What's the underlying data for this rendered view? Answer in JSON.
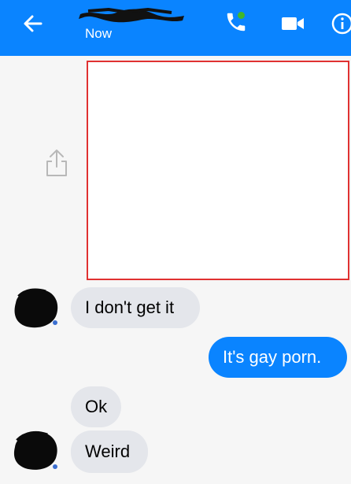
{
  "header": {
    "status": "Now",
    "colors": {
      "bar": "#0a84ff",
      "online_dot": "#42b72a"
    },
    "icons": [
      "back-arrow-icon",
      "phone-icon",
      "video-camera-icon",
      "info-icon"
    ]
  },
  "chat": {
    "share_icon": "share-icon",
    "image_placeholder_color": "#e03131",
    "messages": [
      {
        "direction": "incoming",
        "text": "I don't get it"
      },
      {
        "direction": "outgoing",
        "text": "It's gay porn."
      },
      {
        "direction": "incoming",
        "text": "Ok"
      },
      {
        "direction": "incoming",
        "text": "Weird"
      }
    ]
  }
}
